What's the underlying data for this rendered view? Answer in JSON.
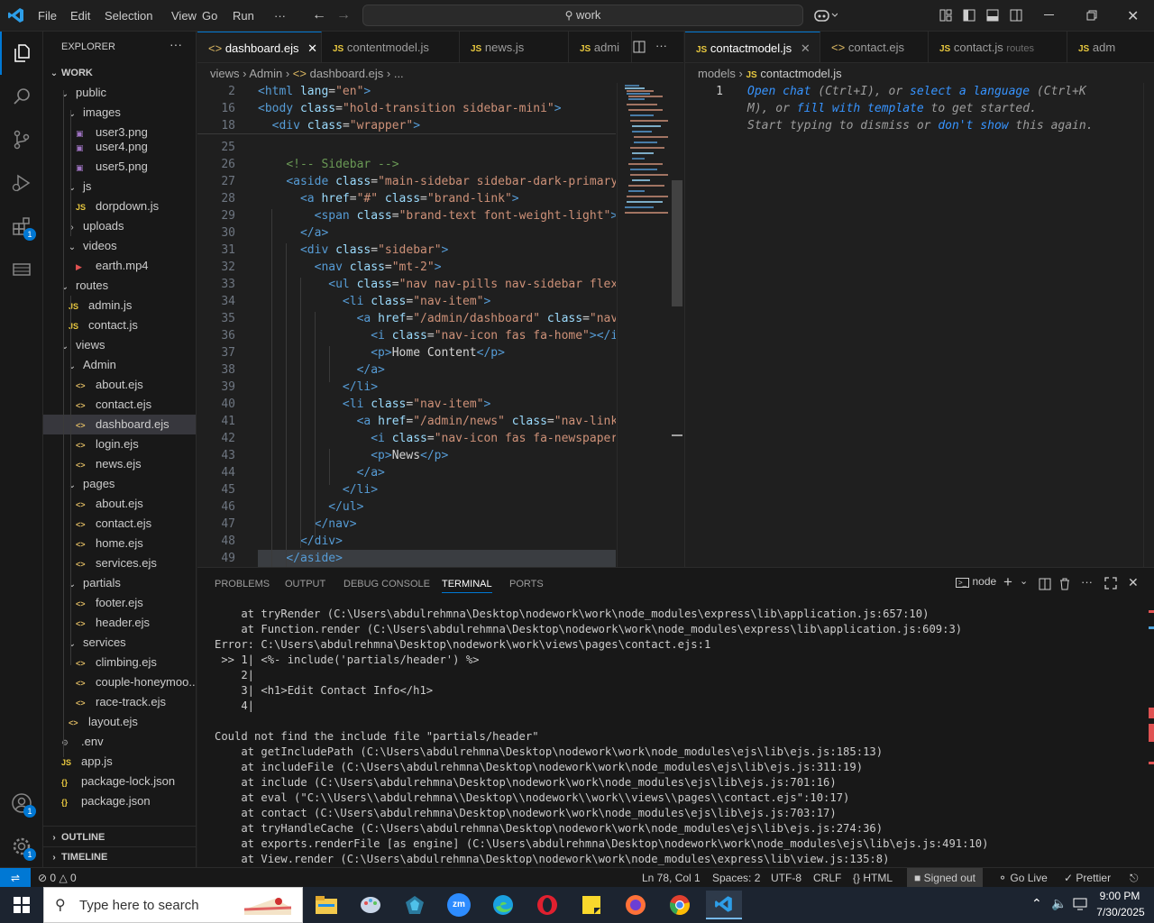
{
  "titlebar": {
    "menus": [
      "File",
      "Edit",
      "Selection",
      "View",
      "Go",
      "Run",
      "···"
    ],
    "search": "work"
  },
  "explorer": {
    "title": "EXPLORER",
    "root": "WORK",
    "items": [
      {
        "label": "public",
        "icon": "chevron-down",
        "depth": 1
      },
      {
        "label": "images",
        "icon": "chevron-down",
        "depth": 2
      },
      {
        "label": "user3.png",
        "icon": "image",
        "depth": 3
      },
      {
        "label": "user4.png",
        "icon": "image",
        "depth": 3
      },
      {
        "label": "user5.png",
        "icon": "image",
        "depth": 3
      },
      {
        "label": "js",
        "icon": "chevron-down",
        "depth": 2
      },
      {
        "label": "dorpdown.js",
        "icon": "js",
        "depth": 3
      },
      {
        "label": "uploads",
        "icon": "chevron-right",
        "depth": 2
      },
      {
        "label": "videos",
        "icon": "chevron-down",
        "depth": 2
      },
      {
        "label": "earth.mp4",
        "icon": "video",
        "depth": 3
      },
      {
        "label": "routes",
        "icon": "chevron-down",
        "depth": 1
      },
      {
        "label": "admin.js",
        "icon": "js",
        "depth": 2
      },
      {
        "label": "contact.js",
        "icon": "js",
        "depth": 2
      },
      {
        "label": "views",
        "icon": "chevron-down",
        "depth": 1
      },
      {
        "label": "Admin",
        "icon": "chevron-down",
        "depth": 2
      },
      {
        "label": "about.ejs",
        "icon": "ejs",
        "depth": 3
      },
      {
        "label": "contact.ejs",
        "icon": "ejs",
        "depth": 3
      },
      {
        "label": "dashboard.ejs",
        "icon": "ejs",
        "depth": 3
      },
      {
        "label": "login.ejs",
        "icon": "ejs",
        "depth": 3
      },
      {
        "label": "news.ejs",
        "icon": "ejs",
        "depth": 3
      },
      {
        "label": "pages",
        "icon": "chevron-down",
        "depth": 2
      },
      {
        "label": "about.ejs",
        "icon": "ejs",
        "depth": 3
      },
      {
        "label": "contact.ejs",
        "icon": "ejs",
        "depth": 3
      },
      {
        "label": "home.ejs",
        "icon": "ejs",
        "depth": 3
      },
      {
        "label": "services.ejs",
        "icon": "ejs",
        "depth": 3
      },
      {
        "label": "partials",
        "icon": "chevron-down",
        "depth": 2
      },
      {
        "label": "footer.ejs",
        "icon": "ejs",
        "depth": 3
      },
      {
        "label": "header.ejs",
        "icon": "ejs",
        "depth": 3
      },
      {
        "label": "services",
        "icon": "chevron-down",
        "depth": 2
      },
      {
        "label": "climbing.ejs",
        "icon": "ejs",
        "depth": 3
      },
      {
        "label": "couple-honeymoo...",
        "icon": "ejs",
        "depth": 3
      },
      {
        "label": "race-track.ejs",
        "icon": "ejs",
        "depth": 3
      },
      {
        "label": "layout.ejs",
        "icon": "ejs",
        "depth": 2
      },
      {
        "label": ".env",
        "icon": "gear",
        "depth": 1
      },
      {
        "label": "app.js",
        "icon": "js",
        "depth": 1
      },
      {
        "label": "package-lock.json",
        "icon": "json",
        "depth": 1
      },
      {
        "label": "package.json",
        "icon": "json",
        "depth": 1
      }
    ],
    "outline": "OUTLINE",
    "timeline": "TIMELINE"
  },
  "editorA": {
    "tabs": [
      "dashboard.ejs",
      "contentmodel.js",
      "news.js",
      "admi"
    ],
    "breadcrumb": [
      "views",
      "Admin",
      "dashboard.ejs",
      "..."
    ],
    "sticky": [
      {
        "n": "2",
        "html": "<span class='tg'>&lt;html</span> <span class='at'>lang</span>=<span class='st'>\"en\"</span><span class='tg'>&gt;</span>"
      },
      {
        "n": "16",
        "html": "<span class='tg'>&lt;body</span> <span class='at'>class</span>=<span class='st'>\"hold-transition sidebar-mini\"</span><span class='tg'>&gt;</span>"
      },
      {
        "n": "18",
        "html": "  <span class='tg'>&lt;div</span> <span class='at'>class</span>=<span class='st'>\"wrapper\"</span><span class='tg'>&gt;</span>"
      }
    ],
    "lines": [
      {
        "n": "25",
        "html": ""
      },
      {
        "n": "26",
        "html": "    <span class='cm'>&lt;!-- Sidebar --&gt;</span>"
      },
      {
        "n": "27",
        "html": "    <span class='tg'>&lt;aside</span> <span class='at'>class</span>=<span class='st'>\"main-sidebar sidebar-dark-primary</span>"
      },
      {
        "n": "28",
        "html": "      <span class='tg'>&lt;a</span> <span class='at'>href</span>=<span class='st'>\"#\"</span> <span class='at'>class</span>=<span class='st'>\"brand-link\"</span><span class='tg'>&gt;</span>"
      },
      {
        "n": "29",
        "html": "        <span class='tg'>&lt;span</span> <span class='at'>class</span>=<span class='st'>\"brand-text font-weight-light\"</span><span class='tg'>&gt;</span>A"
      },
      {
        "n": "30",
        "html": "      <span class='tg'>&lt;/a&gt;</span>"
      },
      {
        "n": "31",
        "html": "      <span class='tg'>&lt;div</span> <span class='at'>class</span>=<span class='st'>\"sidebar\"</span><span class='tg'>&gt;</span>"
      },
      {
        "n": "32",
        "html": "        <span class='tg'>&lt;nav</span> <span class='at'>class</span>=<span class='st'>\"mt-2\"</span><span class='tg'>&gt;</span>"
      },
      {
        "n": "33",
        "html": "          <span class='tg'>&lt;ul</span> <span class='at'>class</span>=<span class='st'>\"nav nav-pills nav-sidebar flex-</span>"
      },
      {
        "n": "34",
        "html": "            <span class='tg'>&lt;li</span> <span class='at'>class</span>=<span class='st'>\"nav-item\"</span><span class='tg'>&gt;</span>"
      },
      {
        "n": "35",
        "html": "              <span class='tg'>&lt;a</span> <span class='at'>href</span>=<span class='st'>\"/admin/dashboard\"</span> <span class='at'>class</span>=<span class='st'>\"nav-</span>"
      },
      {
        "n": "36",
        "html": "                <span class='tg'>&lt;i</span> <span class='at'>class</span>=<span class='st'>\"nav-icon fas fa-home\"</span><span class='tg'>&gt;&lt;/i&gt;</span>"
      },
      {
        "n": "37",
        "html": "                <span class='tg'>&lt;p&gt;</span><span class='tx'>Home Content</span><span class='tg'>&lt;/p&gt;</span>"
      },
      {
        "n": "38",
        "html": "              <span class='tg'>&lt;/a&gt;</span>"
      },
      {
        "n": "39",
        "html": "            <span class='tg'>&lt;/li&gt;</span>"
      },
      {
        "n": "40",
        "html": "            <span class='tg'>&lt;li</span> <span class='at'>class</span>=<span class='st'>\"nav-item\"</span><span class='tg'>&gt;</span>"
      },
      {
        "n": "41",
        "html": "              <span class='tg'>&lt;a</span> <span class='at'>href</span>=<span class='st'>\"/admin/news\"</span> <span class='at'>class</span>=<span class='st'>\"nav-link\"</span>"
      },
      {
        "n": "42",
        "html": "                <span class='tg'>&lt;i</span> <span class='at'>class</span>=<span class='st'>\"nav-icon fas fa-newspaper\"</span>"
      },
      {
        "n": "43",
        "html": "                <span class='tg'>&lt;p&gt;</span><span class='tx'>News</span><span class='tg'>&lt;/p&gt;</span>"
      },
      {
        "n": "44",
        "html": "              <span class='tg'>&lt;/a&gt;</span>"
      },
      {
        "n": "45",
        "html": "            <span class='tg'>&lt;/li&gt;</span>"
      },
      {
        "n": "46",
        "html": "          <span class='tg'>&lt;/ul&gt;</span>"
      },
      {
        "n": "47",
        "html": "        <span class='tg'>&lt;/nav&gt;</span>"
      },
      {
        "n": "48",
        "html": "      <span class='tg'>&lt;/div&gt;</span>"
      },
      {
        "n": "49",
        "html": "    <span class='tg'>&lt;/aside&gt;</span>"
      }
    ]
  },
  "editorB": {
    "tabs": [
      "contactmodel.js",
      "contact.ejs",
      "contact.js",
      "routes",
      "adm"
    ],
    "breadcrumb": [
      "models",
      "contactmodel.js"
    ],
    "line_number": "1",
    "hint": [
      [
        {
          "t": "Open chat",
          "c": "link"
        },
        {
          "t": " (Ctrl+I), or ",
          "c": "dim"
        },
        {
          "t": "select a language",
          "c": "link"
        },
        {
          "t": " (Ctrl+K",
          "c": "dim"
        }
      ],
      [
        {
          "t": "M), or ",
          "c": "dim"
        },
        {
          "t": "fill with template",
          "c": "link"
        },
        {
          "t": " to get started.",
          "c": "dim"
        }
      ],
      [
        {
          "t": "Start typing to dismiss or ",
          "c": "dim"
        },
        {
          "t": "don't show",
          "c": "link"
        },
        {
          "t": " this again.",
          "c": "dim"
        }
      ]
    ]
  },
  "panel": {
    "tabs": [
      "PROBLEMS",
      "OUTPUT",
      "DEBUG CONSOLE",
      "TERMINAL",
      "PORTS"
    ],
    "active": "TERMINAL",
    "shell": "node",
    "terminal": [
      "    at tryRender (C:\\Users\\abdulrehmna\\Desktop\\nodework\\work\\node_modules\\express\\lib\\application.js:657:10)",
      "    at Function.render (C:\\Users\\abdulrehmna\\Desktop\\nodework\\work\\node_modules\\express\\lib\\application.js:609:3)",
      "Error: C:\\Users\\abdulrehmna\\Desktop\\nodework\\work\\views\\pages\\contact.ejs:1",
      " >> 1| <%- include('partials/header') %>",
      "    2|",
      "    3| <h1>Edit Contact Info</h1>",
      "    4|",
      "",
      "Could not find the include file \"partials/header\"",
      "    at getIncludePath (C:\\Users\\abdulrehmna\\Desktop\\nodework\\work\\node_modules\\ejs\\lib\\ejs.js:185:13)",
      "    at includeFile (C:\\Users\\abdulrehmna\\Desktop\\nodework\\work\\node_modules\\ejs\\lib\\ejs.js:311:19)",
      "    at include (C:\\Users\\abdulrehmna\\Desktop\\nodework\\work\\node_modules\\ejs\\lib\\ejs.js:701:16)",
      "    at eval (\"C:\\\\Users\\\\abdulrehmna\\\\Desktop\\\\nodework\\\\work\\\\views\\\\pages\\\\contact.ejs\":10:17)",
      "    at contact (C:\\Users\\abdulrehmna\\Desktop\\nodework\\work\\node_modules\\ejs\\lib\\ejs.js:703:17)",
      "    at tryHandleCache (C:\\Users\\abdulrehmna\\Desktop\\nodework\\work\\node_modules\\ejs\\lib\\ejs.js:274:36)",
      "    at exports.renderFile [as engine] (C:\\Users\\abdulrehmna\\Desktop\\nodework\\work\\node_modules\\ejs\\lib\\ejs.js:491:10)",
      "    at View.render (C:\\Users\\abdulrehmna\\Desktop\\nodework\\work\\node_modules\\express\\lib\\view.js:135:8)"
    ]
  },
  "status": {
    "errors": "0",
    "warnings": "0",
    "position": "Ln 78, Col 1",
    "spaces": "Spaces: 2",
    "encoding": "UTF-8",
    "eol": "CRLF",
    "language": "HTML",
    "signed": "Signed out",
    "golive": "Go Live",
    "prettier": "Prettier"
  },
  "taskbar": {
    "search": "Type here to search",
    "time": "9:00 PM",
    "date": "7/30/2025"
  },
  "colors": {
    "accent": "#0078d4",
    "badge": "#0078d4"
  }
}
